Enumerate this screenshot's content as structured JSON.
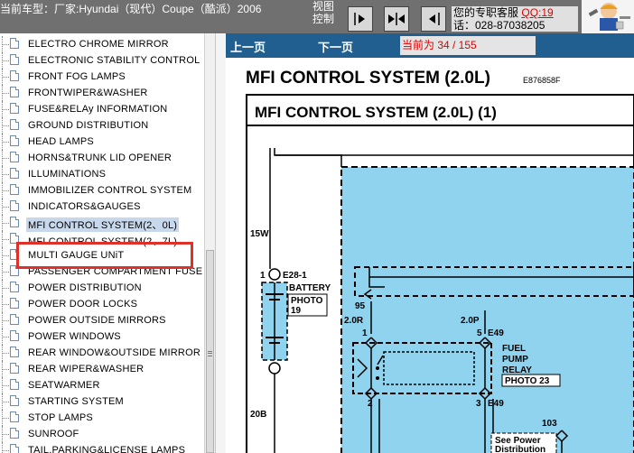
{
  "header": {
    "vehicle": "当前车型：厂家:Hyundai（现代）Coupe（酷派）2006",
    "view_control_line1": "视图",
    "view_control_line2": "控制",
    "service_label": "您的专职客服",
    "service_qq": "QQ:19",
    "service_phone": "话：028-87038205"
  },
  "tree": {
    "items": [
      {
        "label": "ELECTRO CHROME MIRROR"
      },
      {
        "label": "ELECTRONIC STABILITY CONTROL"
      },
      {
        "label": "FRONT FOG LAMPS"
      },
      {
        "label": "FRONTWIPER&WASHER"
      },
      {
        "label": "FUSE&RELAy INFORMATION"
      },
      {
        "label": "GROUND DISTRIBUTION"
      },
      {
        "label": "HEAD LAMPS"
      },
      {
        "label": "HORNS&TRUNK LID OPENER"
      },
      {
        "label": "ILLUMINATIONS"
      },
      {
        "label": "IMMOBILIZER CONTROL SYSTEM"
      },
      {
        "label": "INDICATORS&GAUGES"
      },
      {
        "label": "MFI CONTROL SYSTEM(2、0L)"
      },
      {
        "label": "MFI CONTROL SYSTEM(2、7L)"
      },
      {
        "label": "MULTI GAUGE UNiT"
      },
      {
        "label": "PASSENGER COMPARTMENT FUSE"
      },
      {
        "label": "POWER DISTRIBUTION"
      },
      {
        "label": "POWER DOOR LOCKS"
      },
      {
        "label": "POWER OUTSIDE MIRRORS"
      },
      {
        "label": "POWER WINDOWS"
      },
      {
        "label": "REAR WINDOW&OUTSIDE MIRROR"
      },
      {
        "label": "REAR WIPER&WASHER"
      },
      {
        "label": "SEATWARMER"
      },
      {
        "label": "STARTING SYSTEM"
      },
      {
        "label": "STOP LAMPS"
      },
      {
        "label": "SUNROOF"
      },
      {
        "label": "TAIL,PARKING&LICENSE LAMPS"
      }
    ],
    "selected_index": 11
  },
  "nav": {
    "prev": "上一页",
    "next": "下一页",
    "page_indicator": "当前为 34 / 155"
  },
  "doc": {
    "title": "MFI CONTROL SYSTEM (2.0L)",
    "code": "E876858F",
    "section_title": "MFI CONTROL SYSTEM (2.0L) (1)",
    "labels": {
      "fuse_15w": "15W",
      "pin1": "1",
      "conn_e28": "E28-1",
      "battery": "BATTERY",
      "photo19_a": "PHOTO",
      "photo19_b": "19",
      "wire_20b": "20B",
      "n95": "95",
      "w20r": "2.0R",
      "w20p": "2.0P",
      "relay_pin1": "1",
      "relay_pin5": "5",
      "conn_e49_top": "E49",
      "relay_l1": "FUEL",
      "relay_l2": "PUMP",
      "relay_l3": "RELAY",
      "relay_photo": "PHOTO 23",
      "relay_pin2": "2",
      "relay_pin3": "3",
      "conn_e49_bot": "E49",
      "n103": "103",
      "see_power_1": "See Power",
      "see_power_2": "Distribution"
    }
  },
  "colors": {
    "topbar": "#707070",
    "navstrip": "#205f8f",
    "diagram_fill": "#8fd3ee",
    "selection_frame": "#e0302a",
    "page_indicator_text": "#e00000"
  }
}
